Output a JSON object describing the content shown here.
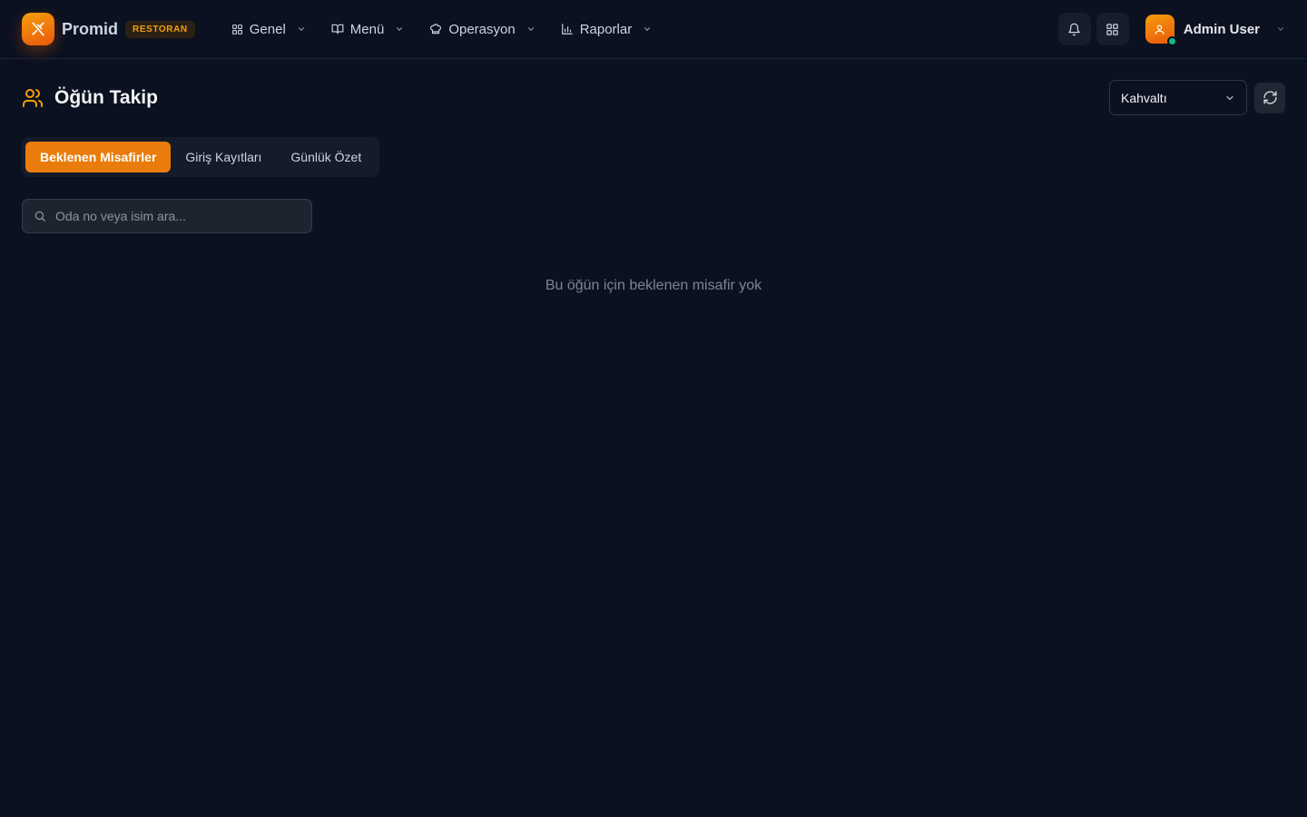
{
  "brand": {
    "name": "Promid",
    "badge": "RESTORAN"
  },
  "nav": [
    {
      "label": "Genel",
      "icon": "grid-icon"
    },
    {
      "label": "Menü",
      "icon": "book-open-icon"
    },
    {
      "label": "Operasyon",
      "icon": "chef-hat-icon"
    },
    {
      "label": "Raporlar",
      "icon": "bar-chart-icon"
    }
  ],
  "user": {
    "name": "Admin User",
    "status": "online"
  },
  "page": {
    "title": "Öğün Takip",
    "meal_select": {
      "value": "Kahvaltı"
    }
  },
  "tabs": [
    {
      "label": "Beklenen Misafirler",
      "active": true
    },
    {
      "label": "Giriş Kayıtları",
      "active": false
    },
    {
      "label": "Günlük Özet",
      "active": false
    }
  ],
  "search": {
    "placeholder": "Oda no veya isim ara...",
    "value": ""
  },
  "empty_state": {
    "message": "Bu öğün için beklenen misafir yok"
  },
  "colors": {
    "background": "#0b1120",
    "accent": "#e97c0c",
    "accent_gradient_start": "#f59e0b",
    "online": "#10b981"
  }
}
